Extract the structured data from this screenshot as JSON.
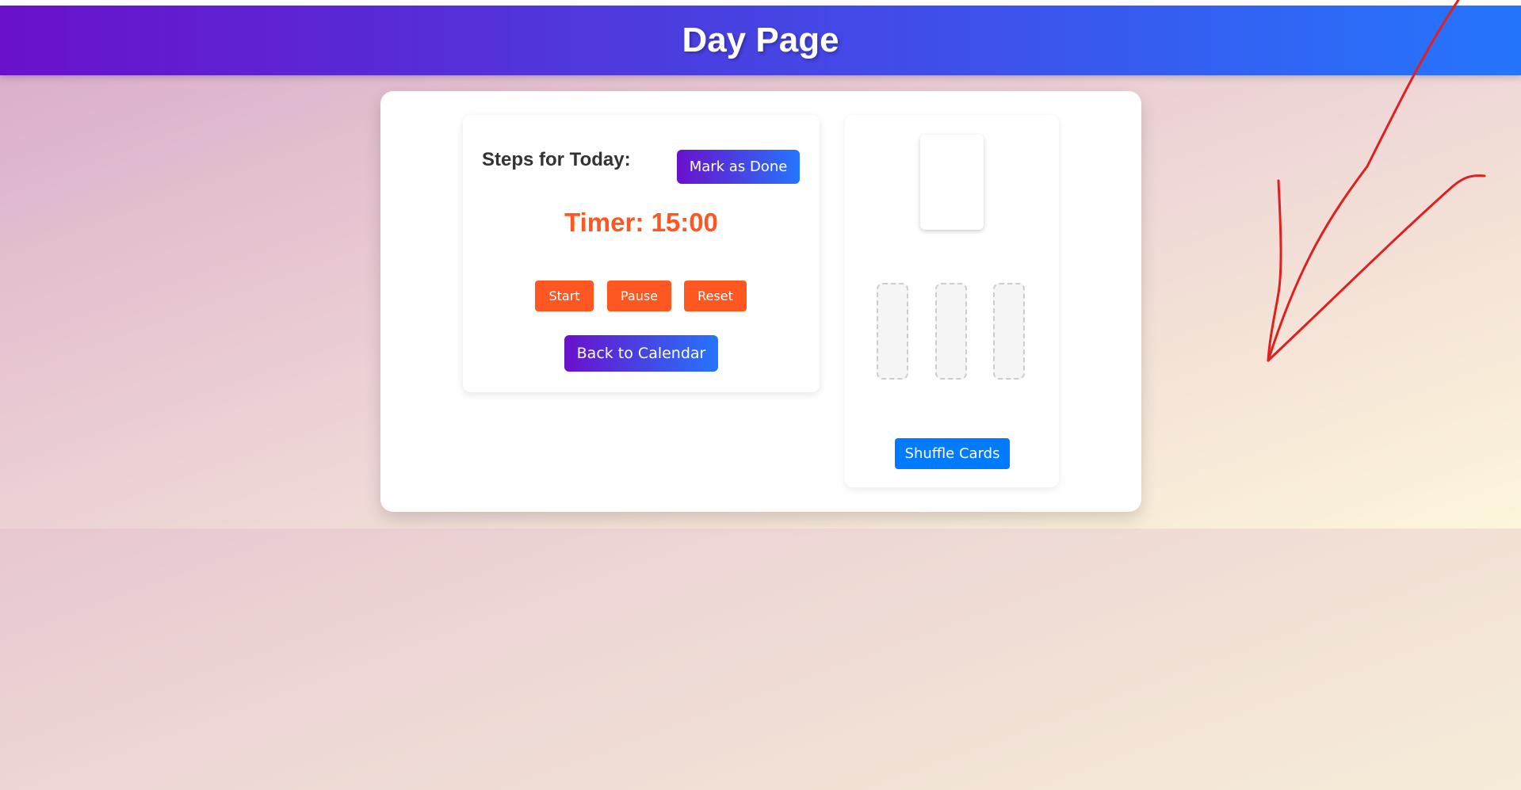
{
  "header": {
    "title": "Day Page"
  },
  "steps": {
    "title": "Steps for Today:",
    "mark_done_label": "Mark as Done",
    "timer_text": "Timer: 15:00",
    "start_label": "Start",
    "pause_label": "Pause",
    "reset_label": "Reset",
    "back_label": "Back to Calendar"
  },
  "cards": {
    "shuffle_label": "Shuffle Cards",
    "slot_count": 3
  },
  "colors": {
    "header_gradient_start": "#6a11cb",
    "header_gradient_end": "#2575fc",
    "timer": "#ff5722",
    "timer_buttons": "#ff5722",
    "shuffle_button": "#007bff",
    "annotation_stroke": "#e02020"
  },
  "annotation": {
    "icon": "red-freehand-arrow-icon"
  }
}
